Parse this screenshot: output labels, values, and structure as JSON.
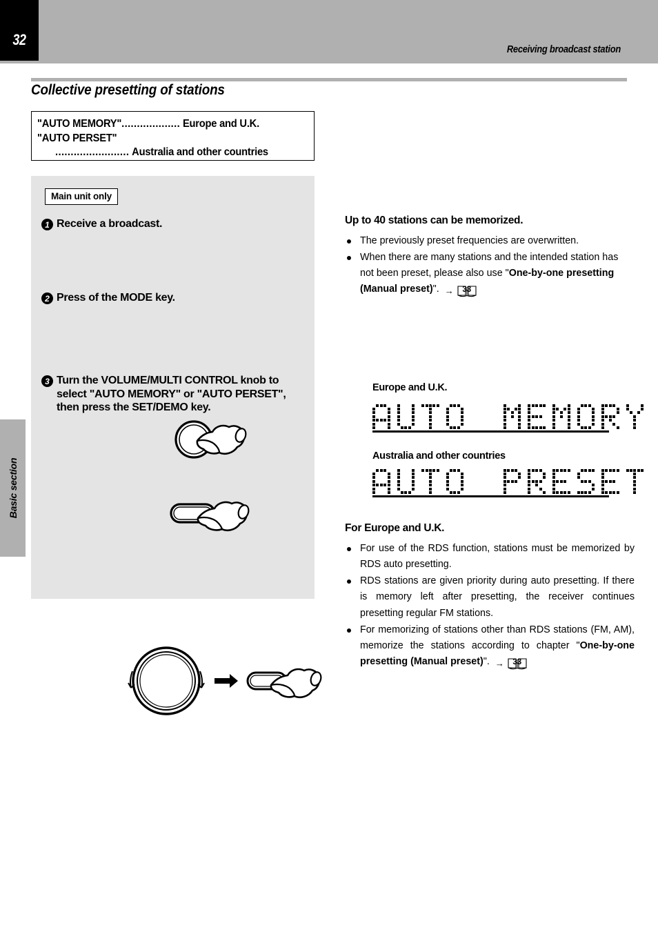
{
  "header": {
    "page_number": "32",
    "title": "Receiving broadcast station"
  },
  "side_tab": {
    "label": "Basic section"
  },
  "section": {
    "title": "Collective presetting of stations"
  },
  "key_box": {
    "line1_term": "\"AUTO MEMORY\"",
    "line1_dots": "...................",
    "line1_region": "Europe and U.K.",
    "line2_term": "\"AUTO PERSET\"",
    "line3_dots": "........................",
    "line3_region": "Australia and other countries"
  },
  "procedure": {
    "badge": "Main unit only",
    "steps": [
      {
        "number": "1",
        "text": "Receive a broadcast."
      },
      {
        "number": "2",
        "text": "Press of the MODE key."
      },
      {
        "number": "3",
        "text": "Turn the VOLUME/MULTI CONTROL knob to select \"AUTO MEMORY\" or \"AUTO PERSET\", then press the SET/DEMO key."
      }
    ]
  },
  "right": {
    "heading_capacity": "Up to 40 stations can be memorized.",
    "bullets_capacity": [
      {
        "parts": [
          {
            "text": "The previously preset frequencies are overwritten.",
            "bold": false
          }
        ]
      },
      {
        "parts": [
          {
            "text": "When there are many stations and the intended station has not been preset, please also use \"",
            "bold": false
          },
          {
            "text": "One-by-one presetting (Manual preset)",
            "bold": true
          },
          {
            "text": "\".",
            "bold": false
          }
        ],
        "pageref": "33"
      }
    ],
    "label_europe": "Europe and U.K.",
    "label_australia": "Australia and other countries",
    "display_europe": "AUTO MEMORY",
    "display_australia": "AUTO PRESET",
    "heading_for_europe": "For Europe and U.K.",
    "bullets_europe": [
      {
        "parts": [
          {
            "text": "For use of the RDS function, stations must be memorized by RDS auto presetting.",
            "bold": false
          }
        ]
      },
      {
        "parts": [
          {
            "text": "RDS stations are given priority during auto presetting. If there is memory left after presetting, the receiver continues presetting regular FM stations.",
            "bold": false
          }
        ]
      },
      {
        "parts": [
          {
            "text": "For memorizing of stations other than RDS stations (FM, AM), memorize the stations according to chapter \"",
            "bold": false
          },
          {
            "text": "One-by-one presetting (Manual preset)",
            "bold": true
          },
          {
            "text": "\".",
            "bold": false
          }
        ],
        "pageref": "33"
      }
    ],
    "pageref_arrow": "→"
  },
  "colors": {
    "header_gray": "#b0b0b0",
    "panel_gray": "#e4e4e4",
    "ink": "#000000"
  }
}
